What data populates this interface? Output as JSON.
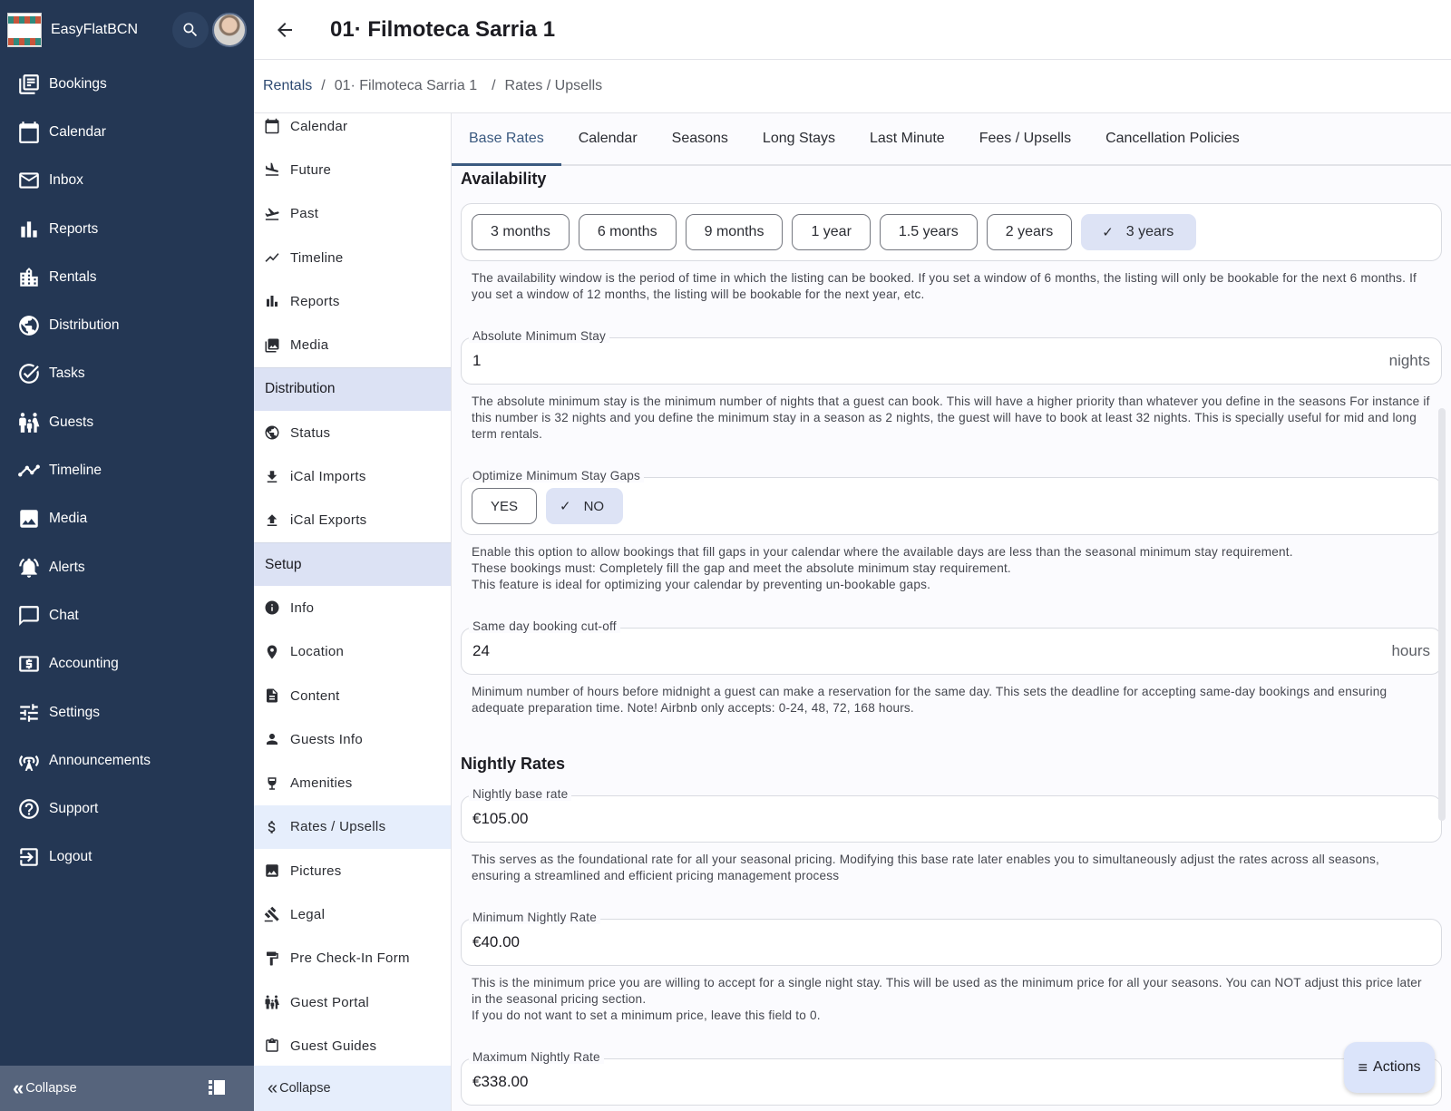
{
  "app": {
    "brand_name": "EasyFlatBCN",
    "nav": [
      {
        "id": "bookings",
        "label": "Bookings",
        "icon": "bookings-icon"
      },
      {
        "id": "calendar",
        "label": "Calendar",
        "icon": "calendar-icon"
      },
      {
        "id": "inbox",
        "label": "Inbox",
        "icon": "mail-icon"
      },
      {
        "id": "reports",
        "label": "Reports",
        "icon": "bar-chart-icon"
      },
      {
        "id": "rentals",
        "label": "Rentals",
        "icon": "building-icon"
      },
      {
        "id": "distribution",
        "label": "Distribution",
        "icon": "globe-icon"
      },
      {
        "id": "tasks",
        "label": "Tasks",
        "icon": "check-circle-icon"
      },
      {
        "id": "guests",
        "label": "Guests",
        "icon": "family-icon"
      },
      {
        "id": "timeline",
        "label": "Timeline",
        "icon": "trend-line-icon"
      },
      {
        "id": "media",
        "label": "Media",
        "icon": "image-icon"
      },
      {
        "id": "alerts",
        "label": "Alerts",
        "icon": "bell-alert-icon"
      },
      {
        "id": "chat",
        "label": "Chat",
        "icon": "chat-bubble-icon"
      },
      {
        "id": "accounting",
        "label": "Accounting",
        "icon": "money-icon"
      },
      {
        "id": "settings",
        "label": "Settings",
        "icon": "sliders-icon"
      },
      {
        "id": "announcements",
        "label": "Announcements",
        "icon": "broadcast-icon"
      },
      {
        "id": "support",
        "label": "Support",
        "icon": "help-circle-icon"
      },
      {
        "id": "logout",
        "label": "Logout",
        "icon": "logout-icon"
      }
    ],
    "collapse_label": "Collapse"
  },
  "header": {
    "title": "01· Filmoteca Sarria 1",
    "breadcrumb": [
      "Rentals",
      "01· Filmoteca Sarria 1",
      "Rates / Upsells"
    ]
  },
  "sub_sidebar": {
    "items_top": [
      {
        "label": "Calendar",
        "icon": "calendar-icon"
      },
      {
        "label": "Future",
        "icon": "flight-land-icon"
      },
      {
        "label": "Past",
        "icon": "flight-takeoff-icon"
      },
      {
        "label": "Timeline",
        "icon": "trend-line-icon"
      },
      {
        "label": "Reports",
        "icon": "bar-chart-icon"
      },
      {
        "label": "Media",
        "icon": "photo-library-icon"
      }
    ],
    "section_distribution": "Distribution",
    "items_distribution": [
      {
        "label": "Status",
        "icon": "globe-icon"
      },
      {
        "label": "iCal Imports",
        "icon": "download-icon"
      },
      {
        "label": "iCal Exports",
        "icon": "upload-icon"
      }
    ],
    "section_setup": "Setup",
    "items_setup": [
      {
        "label": "Info",
        "icon": "info-icon"
      },
      {
        "label": "Location",
        "icon": "location-pin-icon"
      },
      {
        "label": "Content",
        "icon": "document-icon"
      },
      {
        "label": "Guests Info",
        "icon": "person-icon"
      },
      {
        "label": "Amenities",
        "icon": "wine-glass-icon"
      },
      {
        "label": "Rates / Upsells",
        "icon": "dollar-icon",
        "active": true
      },
      {
        "label": "Pictures",
        "icon": "image-icon"
      },
      {
        "label": "Legal",
        "icon": "gavel-icon"
      },
      {
        "label": "Pre Check-In Form",
        "icon": "paint-roller-icon"
      },
      {
        "label": "Guest Portal",
        "icon": "family-icon"
      },
      {
        "label": "Guest Guides",
        "icon": "clipboard-icon"
      }
    ],
    "collapse_label": "Collapse"
  },
  "tabs": [
    {
      "label": "Base Rates",
      "active": true
    },
    {
      "label": "Calendar"
    },
    {
      "label": "Seasons"
    },
    {
      "label": "Long Stays"
    },
    {
      "label": "Last Minute"
    },
    {
      "label": "Fees / Upsells"
    },
    {
      "label": "Cancellation Policies"
    }
  ],
  "availability": {
    "title": "Availability",
    "options": [
      "3 months",
      "6 months",
      "9 months",
      "1 year",
      "1.5 years",
      "2 years",
      "3 years"
    ],
    "selected": "3 years",
    "help": "The availability window is the period of time in which the listing can be booked. If you set a window of 6 months, the listing will only be bookable for the next 6 months. If you set a window of 12 months, the listing will be bookable for the next year, etc."
  },
  "min_stay": {
    "label": "Absolute Minimum Stay",
    "value": "1",
    "suffix": "nights",
    "help": "The absolute minimum stay is the minimum number of nights that a guest can book. This will have a higher priority than whatever you define in the seasons For instance if this number is 32 nights and you define the minimum stay in a season as 2 nights, the guest will have to book at least 32 nights. This is specially useful for mid and long term rentals."
  },
  "optimize_gaps": {
    "label": "Optimize Minimum Stay Gaps",
    "yes_label": "YES",
    "no_label": "NO",
    "selected": "NO",
    "help_lines": [
      "Enable this option to allow bookings that fill gaps in your calendar where the available days are less than the seasonal minimum stay requirement.",
      "These bookings must: Completely fill the gap and meet the absolute minimum stay requirement.",
      "This feature is ideal for optimizing your calendar by preventing un-bookable gaps."
    ]
  },
  "cutoff": {
    "label": "Same day booking cut-off",
    "value": "24",
    "suffix": "hours",
    "help": "Minimum number of hours before midnight a guest can make a reservation for the same day. This sets the deadline for accepting same-day bookings and ensuring adequate preparation time. Note! Airbnb only accepts: 0-24, 48, 72, 168 hours."
  },
  "nightly": {
    "title": "Nightly Rates",
    "base": {
      "label": "Nightly base rate",
      "value": "€105.00",
      "help": "This serves as the foundational rate for all your seasonal pricing. Modifying this base rate later enables you to simultaneously adjust the rates across all seasons, ensuring a streamlined and efficient pricing management process"
    },
    "min": {
      "label": "Minimum Nightly Rate",
      "value": "€40.00",
      "help_lines": [
        "This is the minimum price you are willing to accept for a single night stay. This will be used as the minimum price for all your seasons. You can NOT adjust this price later in the seasonal pricing section.",
        "If you do not want to set a minimum price, leave this field to 0."
      ]
    },
    "max": {
      "label": "Maximum Nightly Rate",
      "value": "€338.00"
    }
  },
  "actions_label": "Actions"
}
